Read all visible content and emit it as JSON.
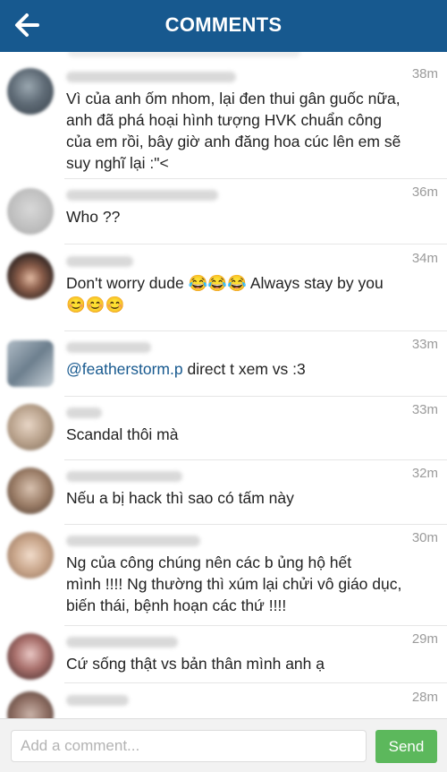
{
  "header": {
    "title": "COMMENTS",
    "back_icon": "arrow-left-icon",
    "color": "#17598f"
  },
  "comments": [
    {
      "time": "38m",
      "text": "Vì của anh ốm nhom, lại đen thui gân guốc nữa,\nanh đã phá hoại hình tượng HVK chuẩn công\ncủa em rồi, bây giờ anh đăng hoa cúc lên em sẽ\nsuy nghĩ lại :\"<"
    },
    {
      "time": "36m",
      "text": "Who ??"
    },
    {
      "time": "34m",
      "text": "Don't worry dude 😂😂😂 Always stay by you\n😊😊😊"
    },
    {
      "time": "33m",
      "mention": "@featherstorm.p",
      "text": " direct t xem vs :3"
    },
    {
      "time": "33m",
      "text": "Scandal thôi mà"
    },
    {
      "time": "32m",
      "text": "Nếu a bị hack thì sao có tấm này"
    },
    {
      "time": "30m",
      "text": "Ng của công chúng nên các b ủng hộ hết\nmình !!!! Ng thường thì xúm lại chửi vô giáo dục,\nbiến thái, bệnh hoạn các thứ !!!!"
    },
    {
      "time": "29m",
      "text": "Cứ sống thật vs bản thân mình anh ạ"
    },
    {
      "time": "28m",
      "text": ""
    }
  ],
  "composer": {
    "placeholder": "Add a comment...",
    "send_label": "Send",
    "send_color": "#5cb85c"
  }
}
